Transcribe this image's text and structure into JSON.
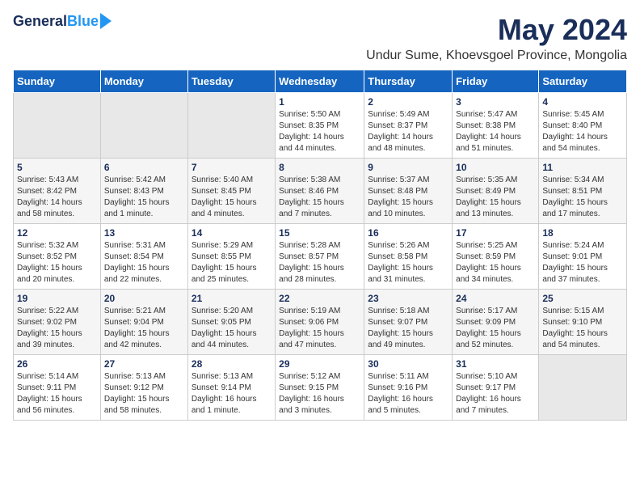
{
  "header": {
    "logo_general": "General",
    "logo_blue": "Blue",
    "month_title": "May 2024",
    "location": "Undur Sume, Khoevsgoel Province, Mongolia"
  },
  "days_of_week": [
    "Sunday",
    "Monday",
    "Tuesday",
    "Wednesday",
    "Thursday",
    "Friday",
    "Saturday"
  ],
  "weeks": [
    [
      {
        "num": "",
        "info": ""
      },
      {
        "num": "",
        "info": ""
      },
      {
        "num": "",
        "info": ""
      },
      {
        "num": "1",
        "info": "Sunrise: 5:50 AM\nSunset: 8:35 PM\nDaylight: 14 hours\nand 44 minutes."
      },
      {
        "num": "2",
        "info": "Sunrise: 5:49 AM\nSunset: 8:37 PM\nDaylight: 14 hours\nand 48 minutes."
      },
      {
        "num": "3",
        "info": "Sunrise: 5:47 AM\nSunset: 8:38 PM\nDaylight: 14 hours\nand 51 minutes."
      },
      {
        "num": "4",
        "info": "Sunrise: 5:45 AM\nSunset: 8:40 PM\nDaylight: 14 hours\nand 54 minutes."
      }
    ],
    [
      {
        "num": "5",
        "info": "Sunrise: 5:43 AM\nSunset: 8:42 PM\nDaylight: 14 hours\nand 58 minutes."
      },
      {
        "num": "6",
        "info": "Sunrise: 5:42 AM\nSunset: 8:43 PM\nDaylight: 15 hours\nand 1 minute."
      },
      {
        "num": "7",
        "info": "Sunrise: 5:40 AM\nSunset: 8:45 PM\nDaylight: 15 hours\nand 4 minutes."
      },
      {
        "num": "8",
        "info": "Sunrise: 5:38 AM\nSunset: 8:46 PM\nDaylight: 15 hours\nand 7 minutes."
      },
      {
        "num": "9",
        "info": "Sunrise: 5:37 AM\nSunset: 8:48 PM\nDaylight: 15 hours\nand 10 minutes."
      },
      {
        "num": "10",
        "info": "Sunrise: 5:35 AM\nSunset: 8:49 PM\nDaylight: 15 hours\nand 13 minutes."
      },
      {
        "num": "11",
        "info": "Sunrise: 5:34 AM\nSunset: 8:51 PM\nDaylight: 15 hours\nand 17 minutes."
      }
    ],
    [
      {
        "num": "12",
        "info": "Sunrise: 5:32 AM\nSunset: 8:52 PM\nDaylight: 15 hours\nand 20 minutes."
      },
      {
        "num": "13",
        "info": "Sunrise: 5:31 AM\nSunset: 8:54 PM\nDaylight: 15 hours\nand 22 minutes."
      },
      {
        "num": "14",
        "info": "Sunrise: 5:29 AM\nSunset: 8:55 PM\nDaylight: 15 hours\nand 25 minutes."
      },
      {
        "num": "15",
        "info": "Sunrise: 5:28 AM\nSunset: 8:57 PM\nDaylight: 15 hours\nand 28 minutes."
      },
      {
        "num": "16",
        "info": "Sunrise: 5:26 AM\nSunset: 8:58 PM\nDaylight: 15 hours\nand 31 minutes."
      },
      {
        "num": "17",
        "info": "Sunrise: 5:25 AM\nSunset: 8:59 PM\nDaylight: 15 hours\nand 34 minutes."
      },
      {
        "num": "18",
        "info": "Sunrise: 5:24 AM\nSunset: 9:01 PM\nDaylight: 15 hours\nand 37 minutes."
      }
    ],
    [
      {
        "num": "19",
        "info": "Sunrise: 5:22 AM\nSunset: 9:02 PM\nDaylight: 15 hours\nand 39 minutes."
      },
      {
        "num": "20",
        "info": "Sunrise: 5:21 AM\nSunset: 9:04 PM\nDaylight: 15 hours\nand 42 minutes."
      },
      {
        "num": "21",
        "info": "Sunrise: 5:20 AM\nSunset: 9:05 PM\nDaylight: 15 hours\nand 44 minutes."
      },
      {
        "num": "22",
        "info": "Sunrise: 5:19 AM\nSunset: 9:06 PM\nDaylight: 15 hours\nand 47 minutes."
      },
      {
        "num": "23",
        "info": "Sunrise: 5:18 AM\nSunset: 9:07 PM\nDaylight: 15 hours\nand 49 minutes."
      },
      {
        "num": "24",
        "info": "Sunrise: 5:17 AM\nSunset: 9:09 PM\nDaylight: 15 hours\nand 52 minutes."
      },
      {
        "num": "25",
        "info": "Sunrise: 5:15 AM\nSunset: 9:10 PM\nDaylight: 15 hours\nand 54 minutes."
      }
    ],
    [
      {
        "num": "26",
        "info": "Sunrise: 5:14 AM\nSunset: 9:11 PM\nDaylight: 15 hours\nand 56 minutes."
      },
      {
        "num": "27",
        "info": "Sunrise: 5:13 AM\nSunset: 9:12 PM\nDaylight: 15 hours\nand 58 minutes."
      },
      {
        "num": "28",
        "info": "Sunrise: 5:13 AM\nSunset: 9:14 PM\nDaylight: 16 hours\nand 1 minute."
      },
      {
        "num": "29",
        "info": "Sunrise: 5:12 AM\nSunset: 9:15 PM\nDaylight: 16 hours\nand 3 minutes."
      },
      {
        "num": "30",
        "info": "Sunrise: 5:11 AM\nSunset: 9:16 PM\nDaylight: 16 hours\nand 5 minutes."
      },
      {
        "num": "31",
        "info": "Sunrise: 5:10 AM\nSunset: 9:17 PM\nDaylight: 16 hours\nand 7 minutes."
      },
      {
        "num": "",
        "info": ""
      }
    ]
  ]
}
